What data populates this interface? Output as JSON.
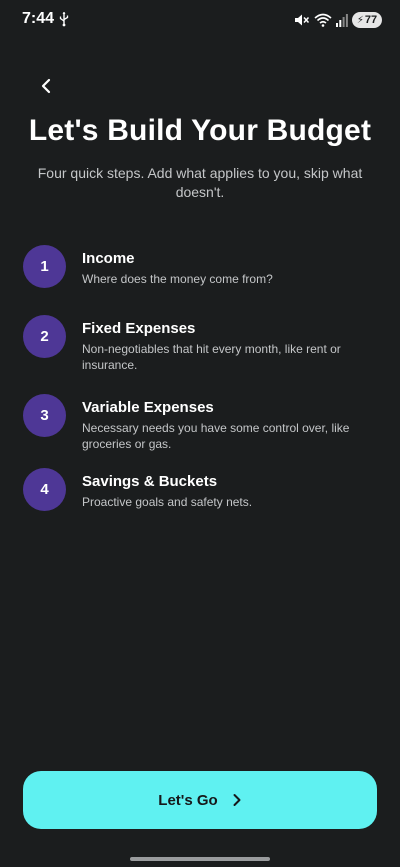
{
  "status_bar": {
    "time": "7:44",
    "battery_level": "77"
  },
  "header": {
    "title": "Let's Build Your Budget",
    "subtitle": "Four quick steps. Add what applies to you, skip what doesn't."
  },
  "steps": [
    {
      "number": "1",
      "title": "Income",
      "description": "Where does the money come from?"
    },
    {
      "number": "2",
      "title": "Fixed Expenses",
      "description": "Non-negotiables that hit every month, like rent or insurance."
    },
    {
      "number": "3",
      "title": "Variable Expenses",
      "description": "Necessary needs you have some control over, like groceries or gas."
    },
    {
      "number": "4",
      "title": "Savings & Buckets",
      "description": "Proactive goals and safety nets."
    }
  ],
  "cta": {
    "label": "Let's Go"
  },
  "colors": {
    "background": "#1b1d1e",
    "step_circle": "#4e3796",
    "cta_background": "#5ff1f1",
    "secondary_text": "#c4c6c8"
  },
  "icons": {
    "back": "chevron-left-icon",
    "cta_arrow": "chevron-right-icon",
    "usb": "usb-icon",
    "mute": "volume-mute-icon",
    "wifi": "wifi-icon",
    "signal": "signal-icon",
    "battery": "battery-icon"
  }
}
